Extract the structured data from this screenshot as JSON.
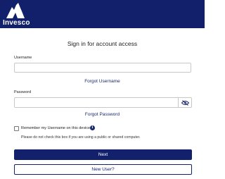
{
  "brand": {
    "logo_text": "Invesco",
    "color": "#121f6b"
  },
  "title": "Sign in for account access",
  "username": {
    "label": "Username",
    "value": "",
    "placeholder": ""
  },
  "forgot_username": "Forgot Username",
  "password": {
    "label": "Password",
    "value": "",
    "placeholder": "",
    "toggle_icon": "eye-slash-icon"
  },
  "forgot_password": "Forgot Password",
  "remember": {
    "label": "Remember my Username on this device",
    "checked": false,
    "info_icon": "info-icon",
    "info_glyph": "i"
  },
  "help_text": "Please do not check this box if you are using a public or shared computer.",
  "buttons": {
    "next": "Next",
    "new_user": "New User?"
  },
  "colors": {
    "accent": "#13206c",
    "link": "#1b2a6e"
  }
}
